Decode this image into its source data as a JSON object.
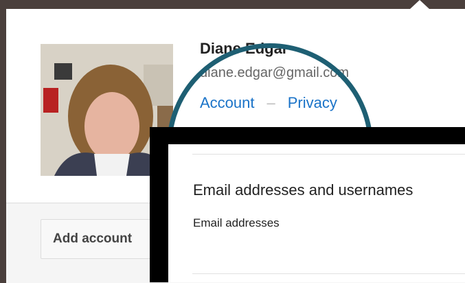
{
  "profile": {
    "name": "Diane Edgar",
    "email": "diane.edgar@gmail.com",
    "account_link": "Account",
    "separator": "–",
    "privacy_link": "Privacy"
  },
  "footer": {
    "add_account_label": "Add account"
  },
  "settings_panel": {
    "section_title": "Email addresses and usernames",
    "email_addresses_label": "Email addresses"
  },
  "colors": {
    "link": "#1a73c8",
    "highlight_circle": "#1e5f73",
    "background": "#4a3f3c"
  }
}
